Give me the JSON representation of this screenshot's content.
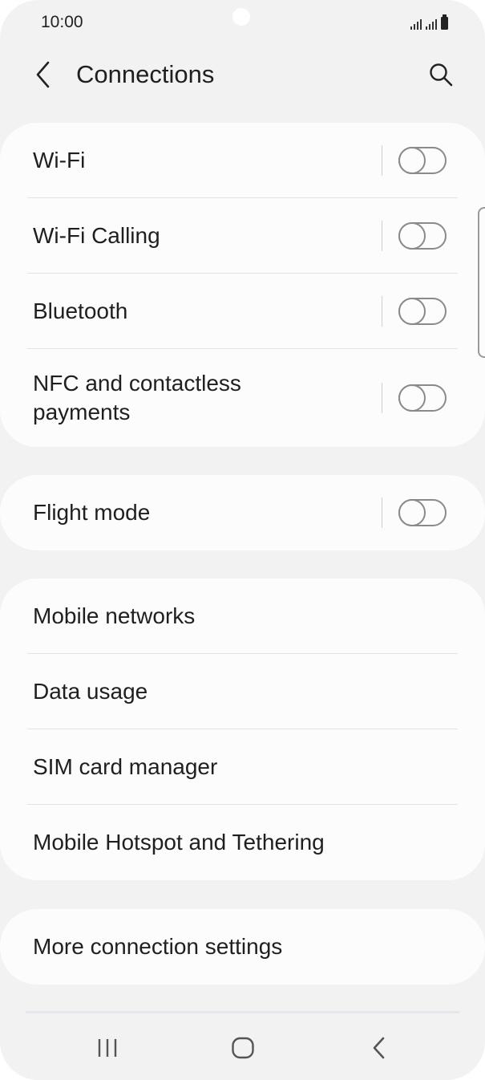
{
  "status_bar": {
    "time": "10:00",
    "icons": [
      "signal-sim1-icon",
      "signal-sim2-icon",
      "battery-icon"
    ]
  },
  "header": {
    "title": "Connections",
    "back_icon": "chevron-left-icon",
    "search_icon": "search-icon"
  },
  "groups": [
    {
      "items": [
        {
          "label": "Wi-Fi",
          "toggle": "off"
        },
        {
          "label": "Wi-Fi Calling",
          "toggle": "off"
        },
        {
          "label": "Bluetooth",
          "toggle": "off"
        },
        {
          "label": "NFC and contactless payments",
          "toggle": "off"
        }
      ]
    },
    {
      "items": [
        {
          "label": "Flight mode",
          "toggle": "off"
        }
      ]
    },
    {
      "items": [
        {
          "label": "Mobile networks"
        },
        {
          "label": "Data usage"
        },
        {
          "label": "SIM card manager"
        },
        {
          "label": "Mobile Hotspot and Tethering"
        }
      ]
    },
    {
      "items": [
        {
          "label": "More connection settings"
        }
      ]
    }
  ],
  "nav_bar": {
    "recents_icon": "recents-icon",
    "home_icon": "home-icon",
    "back_icon": "back-icon"
  }
}
